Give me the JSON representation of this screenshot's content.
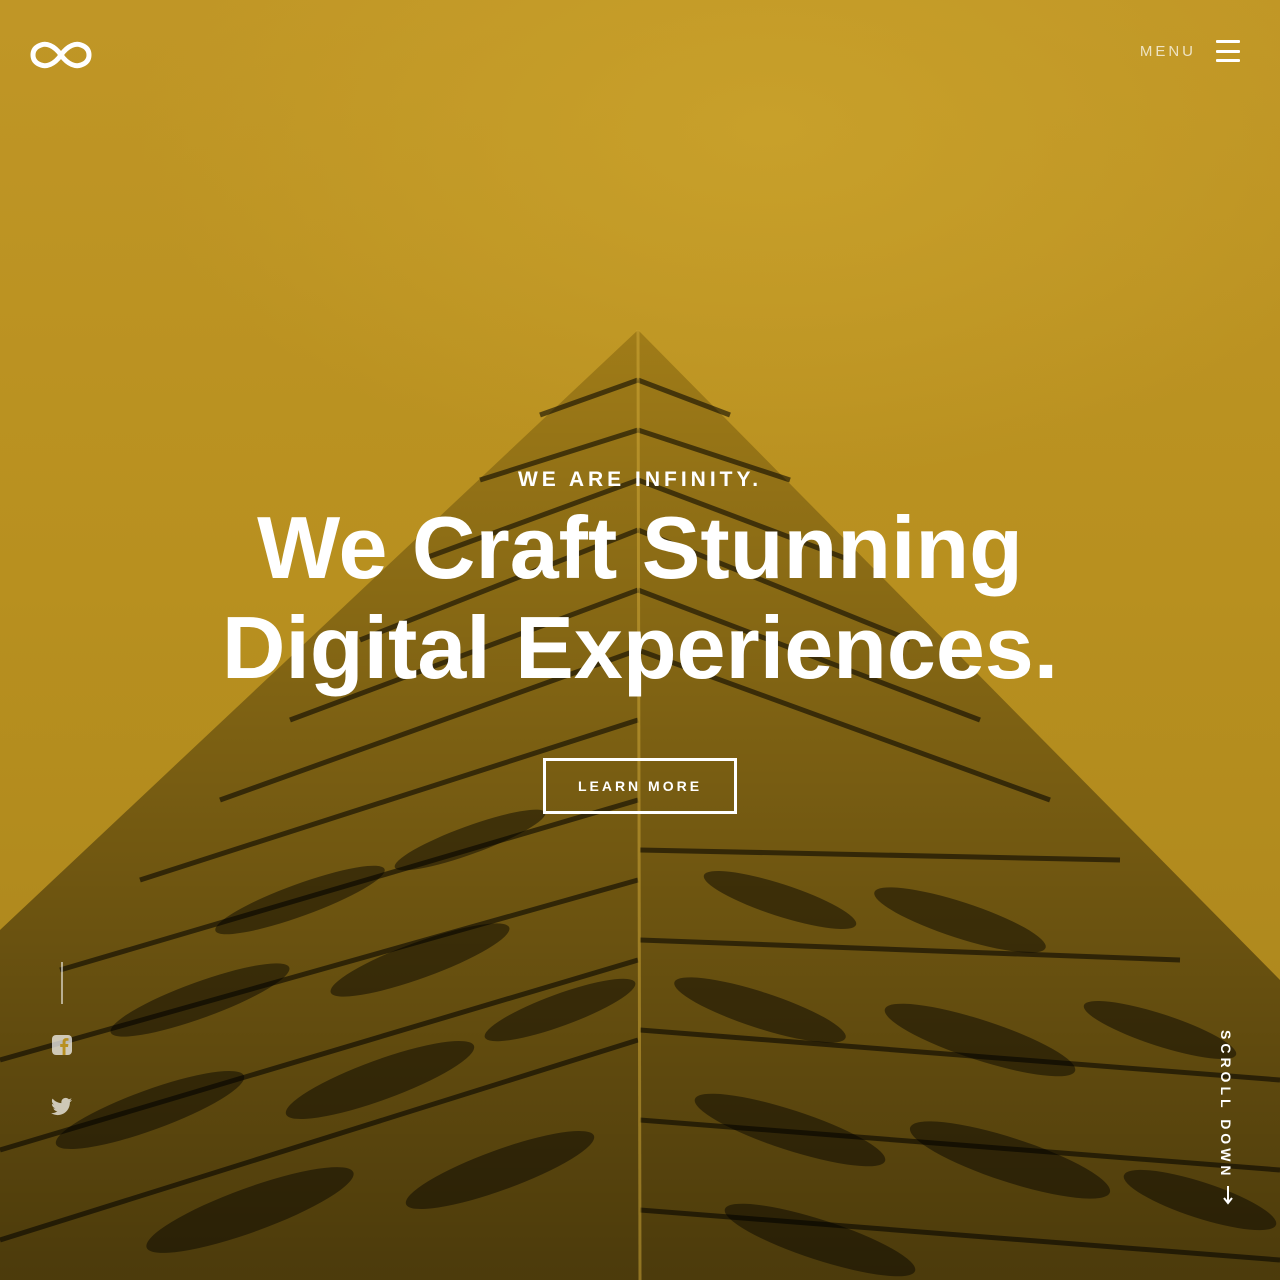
{
  "header": {
    "logo_icon": "infinity-icon",
    "menu_label": "MENU",
    "menu_icon": "hamburger-icon"
  },
  "hero": {
    "eyebrow": "WE ARE INFINITY.",
    "headline_line1": "We Craft Stunning",
    "headline_line2": "Digital Experiences.",
    "cta_label": "LEARN MORE"
  },
  "social": {
    "items": [
      {
        "icon": "facebook-icon"
      },
      {
        "icon": "twitter-icon"
      }
    ]
  },
  "scroll": {
    "label": "SCROLL DOWN",
    "icon": "arrow-down-icon"
  },
  "colors": {
    "background_tint": "#b8901f",
    "text": "#ffffff"
  }
}
